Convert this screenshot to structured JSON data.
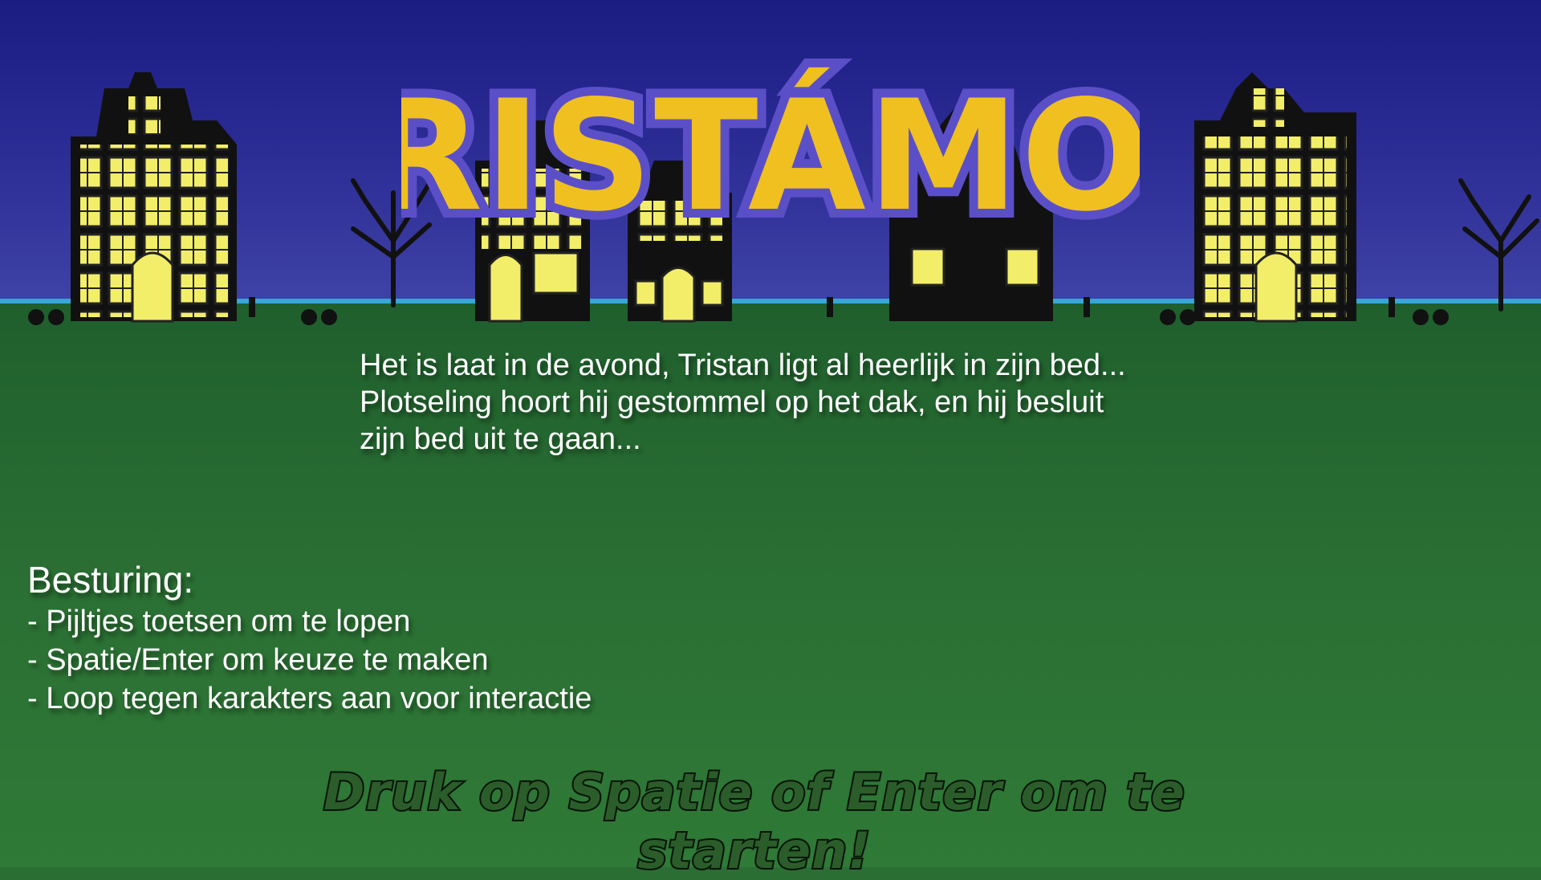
{
  "title": "TRISTÁMON",
  "story": {
    "line1": "Het is laat in de avond, Tristan ligt al heerlijk in zijn bed...",
    "line2": "Plotseling hoort hij gestommel op het dak, en hij besluit",
    "line3": "zijn bed uit te gaan..."
  },
  "controls": {
    "heading": "Besturing:",
    "items": [
      "- Pijltjes toetsen om te lopen",
      "- Spatie/Enter om keuze te maken",
      "- Loop tegen karakters aan voor interactie"
    ]
  },
  "start_prompt": "Druk op Spatie of Enter om te starten!",
  "colors": {
    "sky": "#1b1d82",
    "ground": "#2a6e33",
    "horizon": "#37a6d8",
    "logo_fill": "#f0c020",
    "logo_outline": "#5b4fc8",
    "window": "#f3ee6a",
    "house": "#111111"
  }
}
